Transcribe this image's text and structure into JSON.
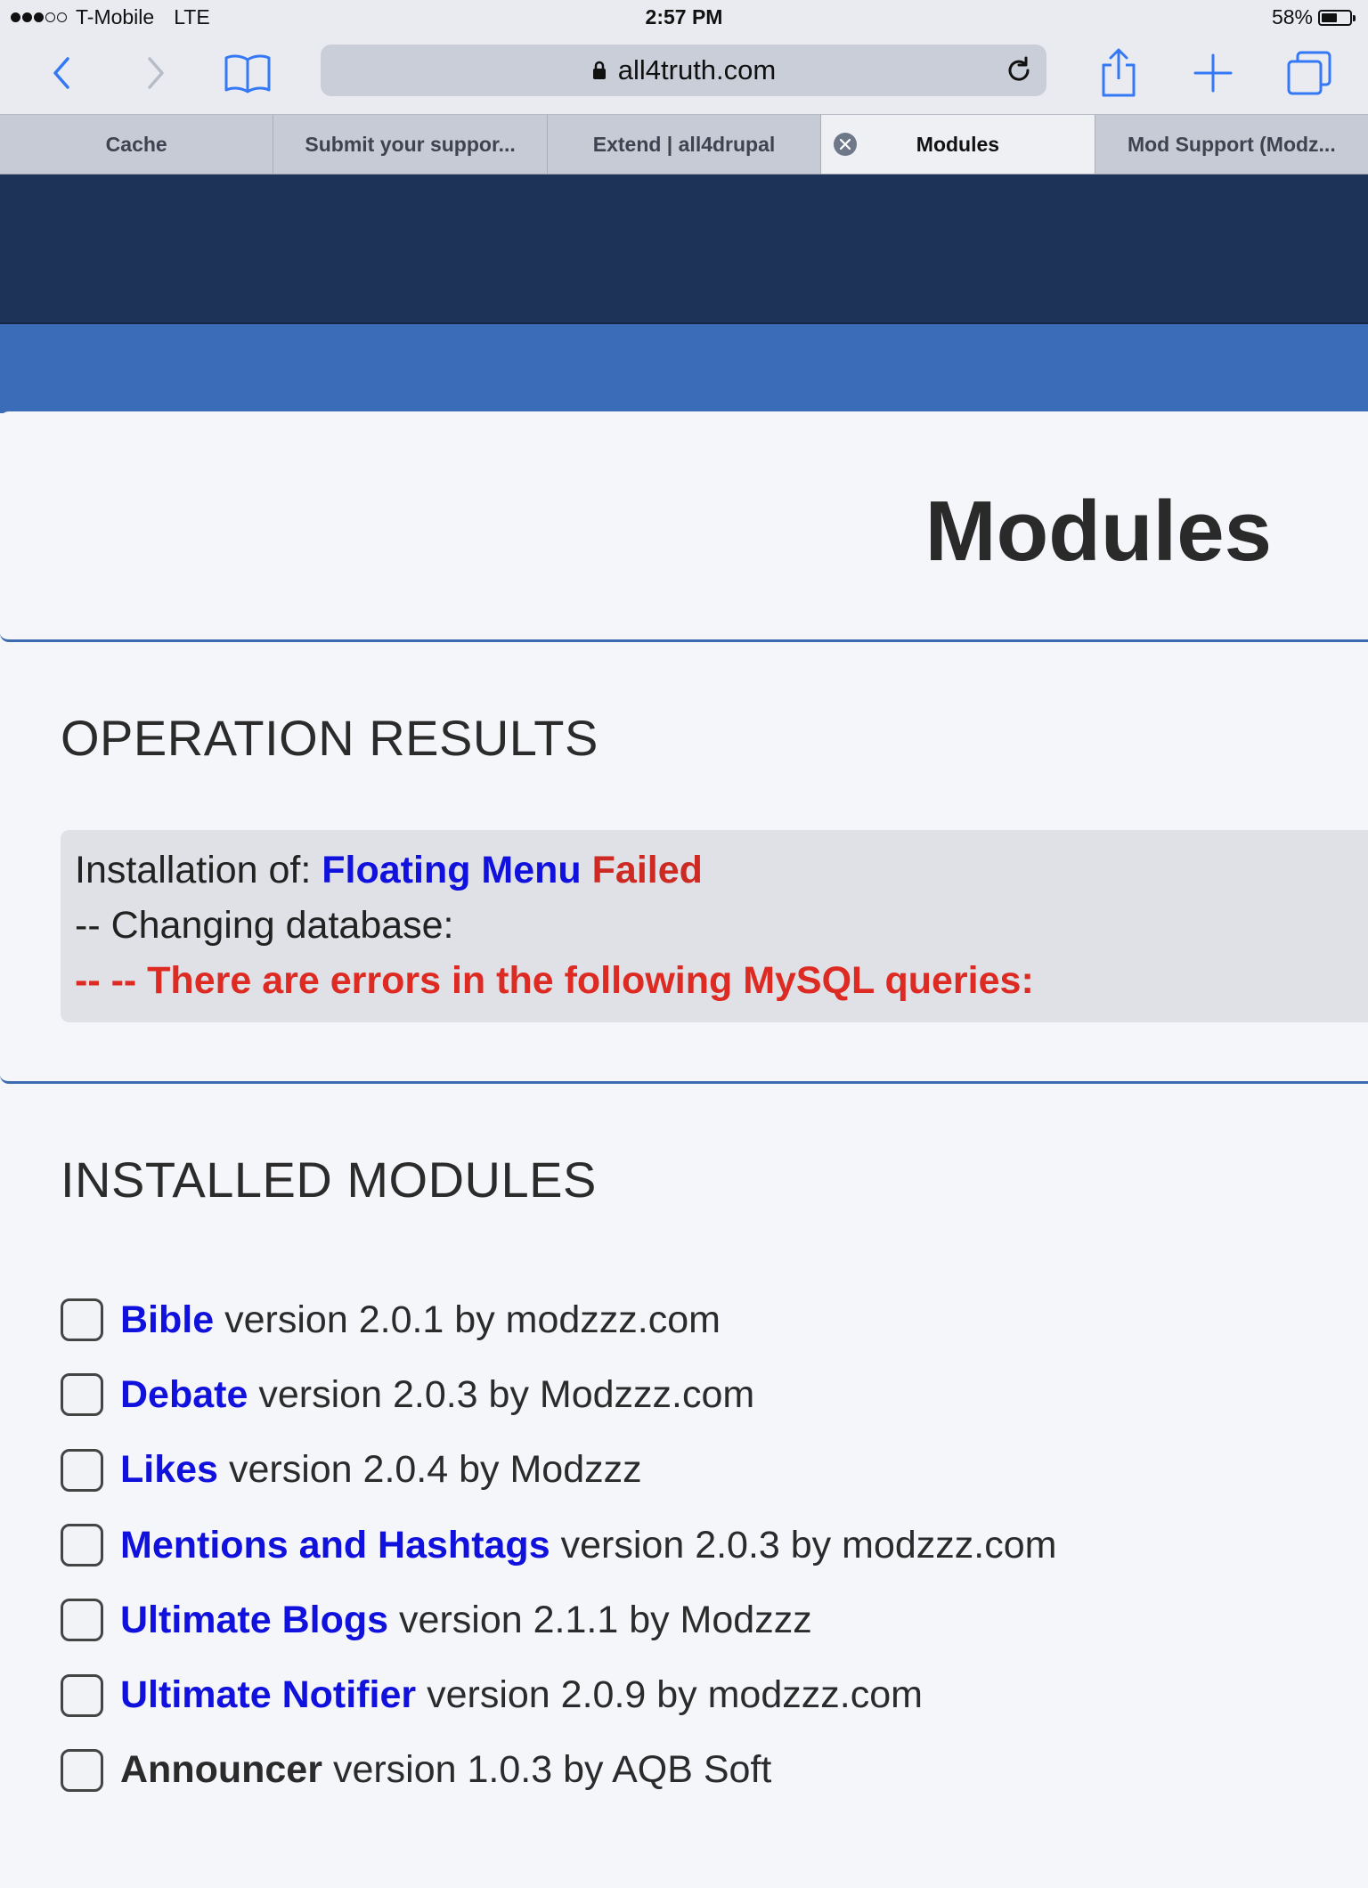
{
  "status_bar": {
    "carrier": "T-Mobile",
    "network": "LTE",
    "time": "2:57 PM",
    "battery_percent": "58%",
    "battery_level": 0.58,
    "signal_bars_filled": 3,
    "signal_bars_total": 5
  },
  "toolbar": {
    "url": "all4truth.com",
    "icons": [
      "back-icon",
      "forward-icon",
      "bookmarks-icon",
      "lock-icon",
      "reload-icon",
      "share-icon",
      "new-tab-icon",
      "tabs-icon"
    ]
  },
  "tabs": [
    {
      "label": "Cache",
      "active": false
    },
    {
      "label": "Submit your suppor...",
      "active": false
    },
    {
      "label": "Extend | all4drupal",
      "active": false
    },
    {
      "label": "Modules",
      "active": true
    },
    {
      "label": "Mod Support (Modz...",
      "active": false
    }
  ],
  "page": {
    "title": "Modules"
  },
  "operation_results": {
    "heading": "OPERATION RESULTS",
    "installation_prefix": "Installation of:",
    "module_name": "Floating Menu",
    "status": "Failed",
    "line2": "-- Changing database:",
    "line3": "-- -- There are errors in the following MySQL queries:"
  },
  "installed_modules": {
    "heading": "INSTALLED MODULES",
    "items": [
      {
        "name": "Bible",
        "meta": "version 2.0.1 by modzzz.com",
        "is_link": true
      },
      {
        "name": "Debate",
        "meta": "version 2.0.3 by Modzzz.com",
        "is_link": true
      },
      {
        "name": "Likes",
        "meta": "version 2.0.4 by Modzzz",
        "is_link": true
      },
      {
        "name": "Mentions and Hashtags",
        "meta": "version 2.0.3 by modzzz.com",
        "is_link": true
      },
      {
        "name": "Ultimate Blogs",
        "meta": "version 2.1.1 by Modzzz",
        "is_link": true
      },
      {
        "name": "Ultimate Notifier",
        "meta": "version 2.0.9 by modzzz.com",
        "is_link": true
      },
      {
        "name": "Announcer",
        "meta": "version 1.0.3 by AQB Soft",
        "is_link": false
      }
    ]
  },
  "colors": {
    "header_dark": "#1e3358",
    "header_blue": "#3b6cb8",
    "link_blue": "#1111dd",
    "error_red": "#dd2a22"
  }
}
